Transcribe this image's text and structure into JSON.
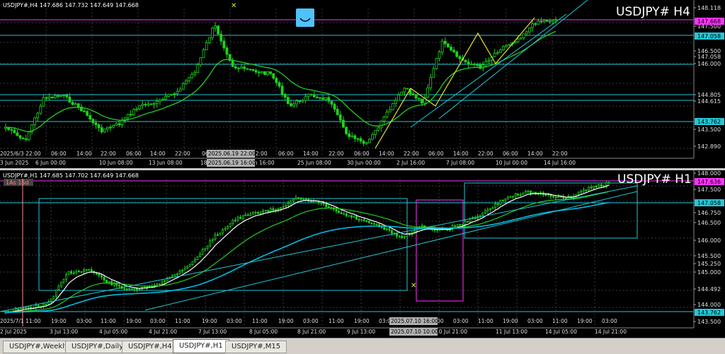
{
  "colors": {
    "background": "#000000",
    "grid": "#3a3a3a",
    "candle": "#1fd11f",
    "ma_fast": "#ffffff",
    "ma_mid": "#22cc22",
    "ma_slow": "#00bfe6",
    "level_line": "#22c8d8",
    "magenta": "#ff33ff",
    "yellow": "#e5e52a"
  },
  "pane_top": {
    "header": "USDJPY#,H4  147.686 147.732 147.649 147.668",
    "watermark": "USDJPY#  H4",
    "icon": "smiley-icon",
    "price_labels": [
      "148.118",
      "147.500",
      "147.058",
      "146.500",
      "146.000",
      "144.805",
      "144.615",
      "143.500",
      "142.890"
    ],
    "highlight_labels": [
      {
        "text": "147.668",
        "color": "#ff33ff"
      },
      {
        "text": "147.058",
        "color": "#22c8d8"
      },
      {
        "text": "143.762",
        "color": "#22c8d8"
      }
    ],
    "time_labels": [
      "2025/6/3 22:00",
      "06:00",
      "14:00",
      "22:00",
      "06:00",
      "14:00",
      "22:00",
      "06:00",
      "14:00",
      "22:00",
      "06:00",
      "14:00",
      "22:00",
      "06:00",
      "14:00",
      "22:00",
      "06:00",
      "14:00",
      "22:00",
      "06:00",
      "14:00",
      "22:00"
    ],
    "date_labels": [
      "3 Jun 2025",
      "6 Jun 00:00",
      "10 Jun 08:00",
      "13 Jun 08:00",
      "18 Jun 08:00",
      "20 Jun 16:00",
      "25 Jun 08:00",
      "30 Jun 00:00",
      "2 Jul 16:00",
      "7 Jul 08:00",
      "10 Jul 00:00",
      "14 Jul 16:00"
    ],
    "cursor_labels": [
      "2025.06.19 22:00",
      "2025.06.19 16:00"
    ]
  },
  "pane_bottom": {
    "header": "USDJPY#,H1  147.685 147.702 147.649 147.668",
    "watermark": "USDJPY#  H1",
    "tag": "1As 1Sd",
    "price_labels": [
      "148.000",
      "147.500",
      "146.750",
      "146.500",
      "146.000",
      "145.500",
      "145.250",
      "145.000",
      "144.492",
      "144.000",
      "143.500"
    ],
    "highlight_labels": [
      {
        "text": "147.636",
        "color": "#ff33ff"
      },
      {
        "text": "147.058",
        "color": "#22c8d8"
      },
      {
        "text": "143.762",
        "color": "#22c8d8"
      }
    ],
    "date_labels": [
      "2 Jul 2025",
      "3 Jul 13:00",
      "4 Jul 05:00",
      "4 Jul 21:00",
      "7 Jul 13:00",
      "8 Jul 05:00",
      "8 Jul 21:00",
      "9 Jul 13:00",
      "10 Jul 21:00",
      "11 Jul 13:00",
      "14 Jul 05:00",
      "14 Jul 21:00"
    ],
    "time_labels": [
      "2025/7/1 11:00",
      "19:00",
      "03:00",
      "11:00",
      "19:00",
      "03:00",
      "11:00",
      "19:00",
      "03:00",
      "11:00",
      "19:00",
      "03:00",
      "11:00",
      "19:00",
      "03:00",
      "11:00",
      "19:00",
      "03:00",
      "11:00",
      "19:00",
      "03:00",
      "11:00",
      "19:00",
      "03:00"
    ],
    "cursor_labels": [
      "2025.07.10 16:00",
      "2025.07.10 10:00"
    ]
  },
  "tabs": [
    "USDJPY#,Weekly",
    "USDJPY#,Daily",
    "USDJPY#,H4",
    "USDJPY#,H1",
    "USDJPY#,M15"
  ],
  "active_tab": "USDJPY#,H1"
}
